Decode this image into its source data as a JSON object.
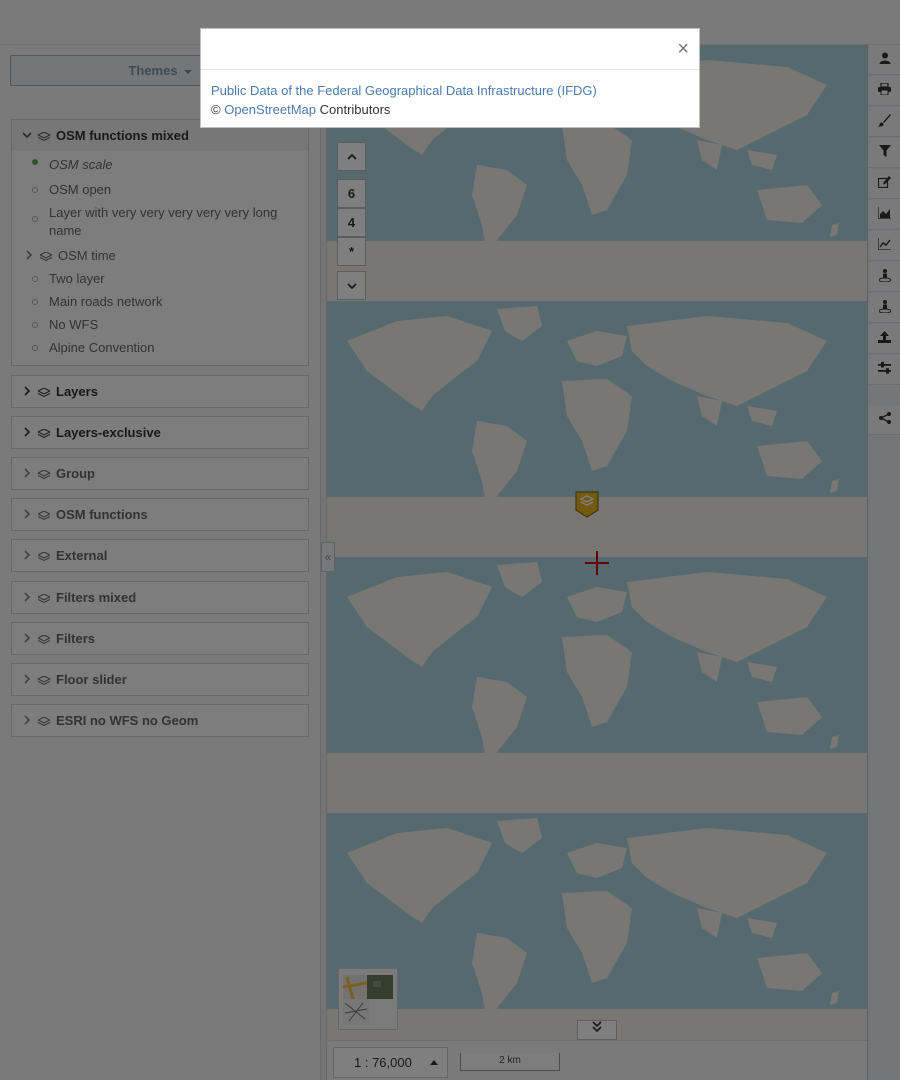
{
  "themes": {
    "label": "Themes"
  },
  "left_panel": {
    "open_group": {
      "title": "OSM functions mixed",
      "items": [
        {
          "label": "OSM scale",
          "selected": true
        },
        {
          "label": "OSM open",
          "selected": false
        },
        {
          "label": "Layer with very very very very very long name",
          "selected": false
        }
      ],
      "subgroup": {
        "title": "OSM time"
      },
      "items_after": [
        {
          "label": "Two layer"
        },
        {
          "label": "Main roads network"
        },
        {
          "label": "No WFS"
        },
        {
          "label": "Alpine Convention"
        }
      ]
    },
    "groups": [
      {
        "title": "Layers"
      },
      {
        "title": "Layers-exclusive"
      },
      {
        "title": "Group"
      },
      {
        "title": "OSM functions"
      },
      {
        "title": "External"
      },
      {
        "title": "Filters mixed"
      },
      {
        "title": "Filters"
      },
      {
        "title": "Floor slider"
      },
      {
        "title": "ESRI no WFS no Geom"
      }
    ]
  },
  "map": {
    "zoom_buttons": [
      "6",
      "4",
      "*"
    ],
    "scale": "1 : 76,000",
    "scale_bar": "2 km"
  },
  "right_toolbar": {
    "icons": [
      "user-icon",
      "print-icon",
      "brush-icon",
      "filter-icon",
      "edit-icon",
      "area-chart-icon",
      "line-chart-icon",
      "street-view-icon",
      "street-view-icon-2",
      "upload-icon",
      "sliders-icon",
      "share-icon"
    ]
  },
  "modal": {
    "close": "×",
    "line1": "Public Data of the Federal Geographical Data Infrastructure (IFDG)",
    "copyright": "©",
    "osm_link": "OpenStreetMap",
    "contributors": "Contributors"
  },
  "colors": {
    "ocean": "#aad3df",
    "land": "#f2efe9",
    "accent": "#4a7bb0",
    "overlay": "rgba(0,0,0,0.5)"
  }
}
